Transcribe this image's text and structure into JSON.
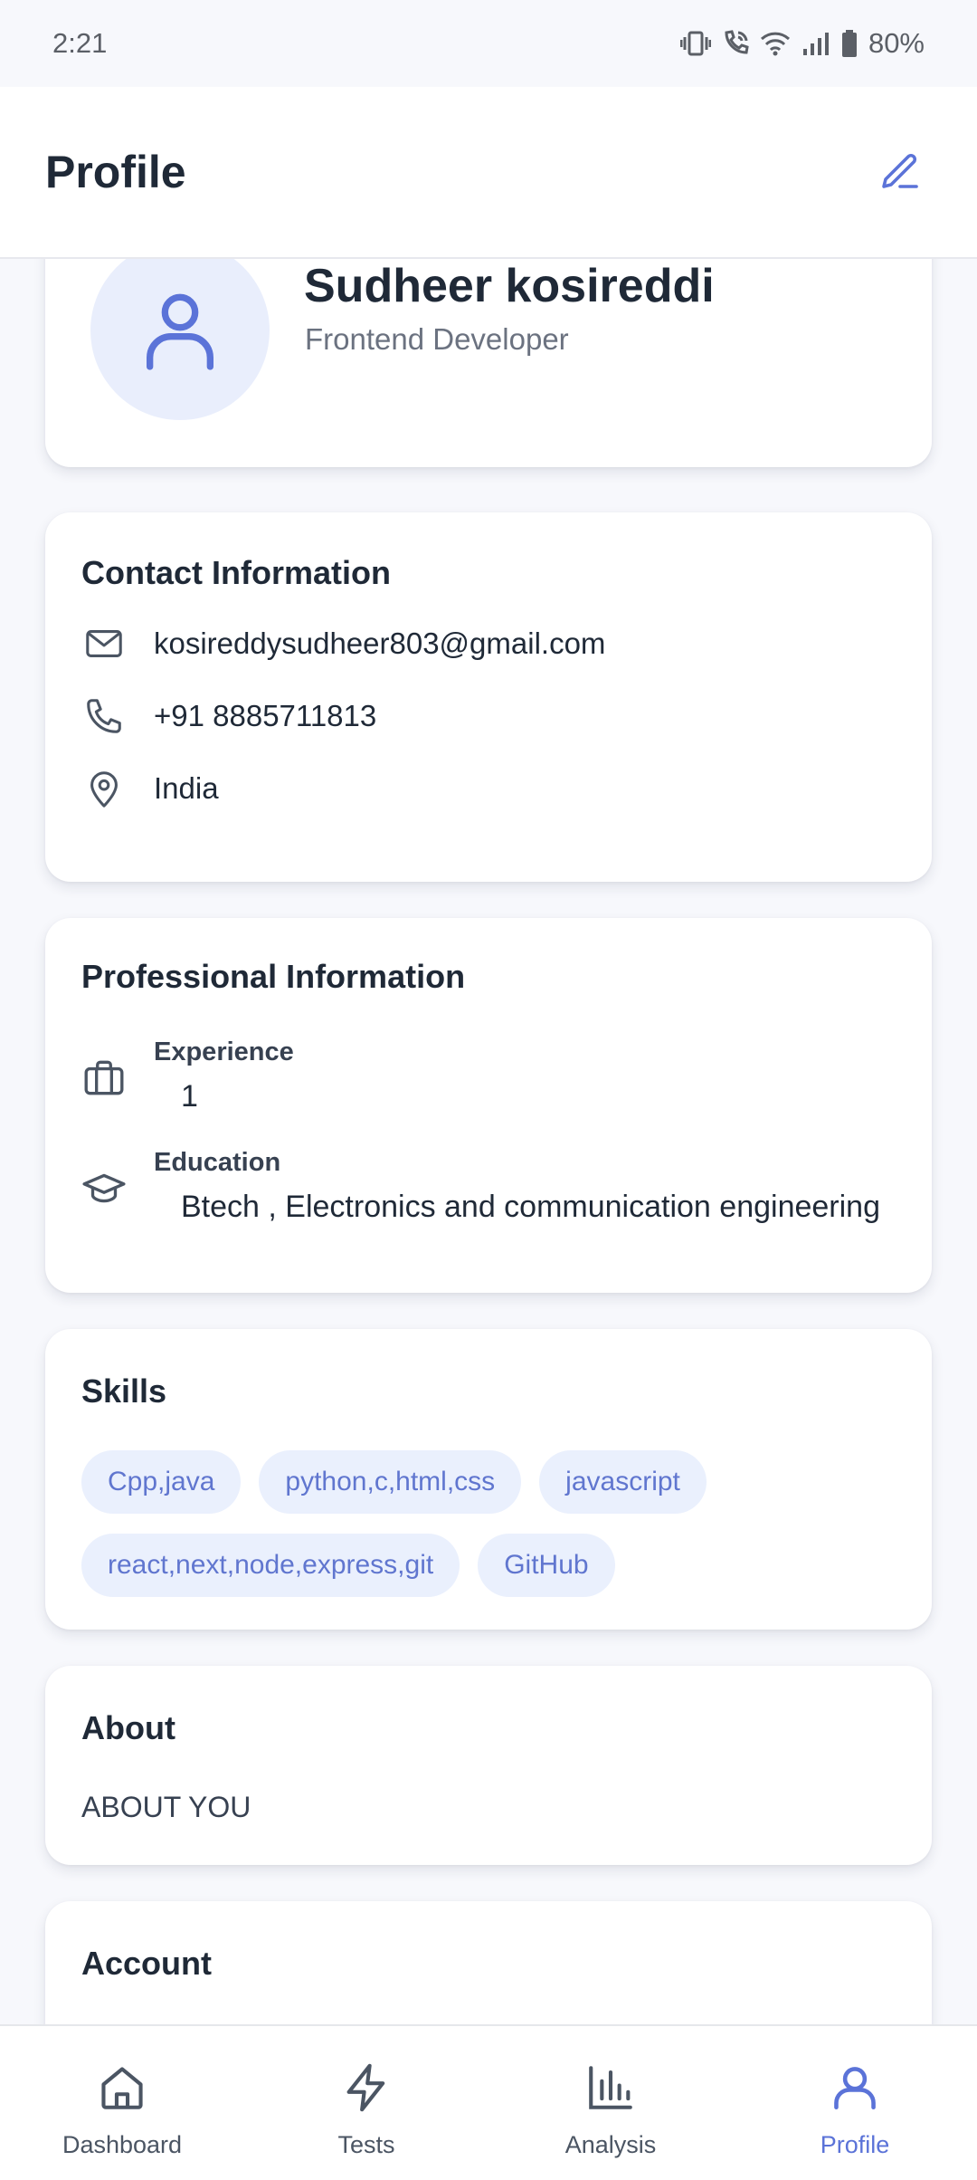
{
  "status_bar": {
    "time": "2:21",
    "battery": "80%",
    "icons": [
      "vibrate-icon",
      "wifi-call-icon",
      "wifi-icon",
      "signal-icon",
      "battery-icon"
    ]
  },
  "header": {
    "title": "Profile",
    "edit_icon": "pencil-icon"
  },
  "profile": {
    "name": "Sudheer kosireddi",
    "role": "Frontend Developer",
    "avatar_icon": "user-icon"
  },
  "contact": {
    "title": "Contact Information",
    "email": "kosireddysudheer803@gmail.com",
    "phone": "+91 8885711813",
    "location": "India"
  },
  "professional": {
    "title": "Professional Information",
    "experience_label": "Experience",
    "experience_value": "1",
    "education_label": "Education",
    "education_value": "Btech , Electronics and communication engineering"
  },
  "skills": {
    "title": "Skills",
    "items": [
      "Cpp,java",
      "python,c,html,css",
      "javascript",
      "react,next,node,express,git",
      "GitHub"
    ]
  },
  "about": {
    "title": "About",
    "text": "ABOUT YOU"
  },
  "account": {
    "title": "Account"
  },
  "nav": {
    "items": [
      {
        "label": "Dashboard",
        "icon": "home-icon"
      },
      {
        "label": "Tests",
        "icon": "lightning-icon"
      },
      {
        "label": "Analysis",
        "icon": "bar-chart-icon"
      },
      {
        "label": "Profile",
        "icon": "user-icon"
      }
    ],
    "active": "Profile"
  },
  "colors": {
    "accent": "#5b73d8",
    "chip_bg": "#eaf0fd",
    "chip_text": "#6076cf",
    "avatar_bg": "#e9eefc",
    "background": "#f7f8fc"
  }
}
